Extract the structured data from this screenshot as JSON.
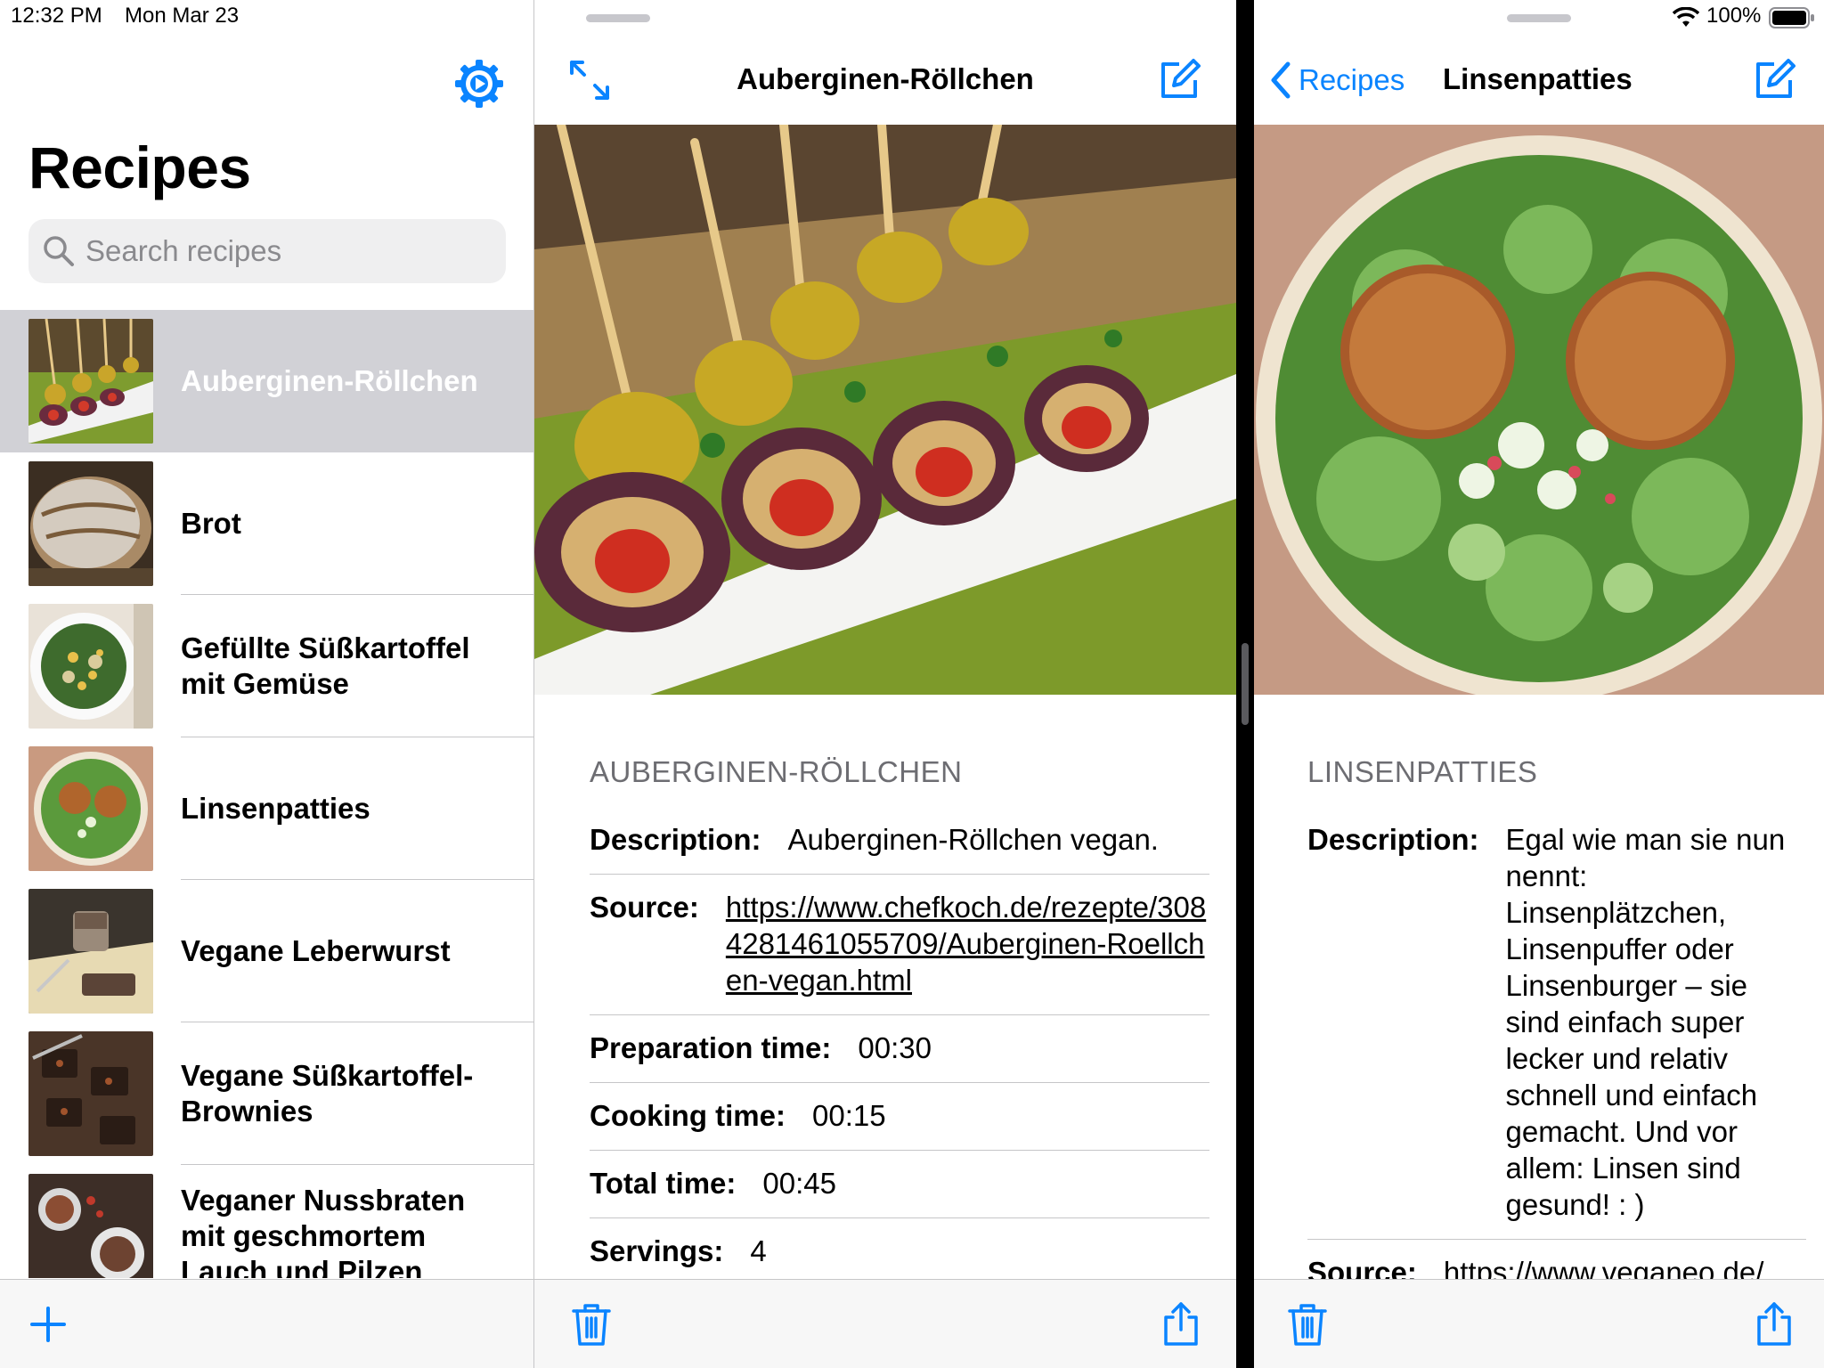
{
  "status_bar": {
    "time": "12:32 PM",
    "date": "Mon Mar 23",
    "battery": "100%"
  },
  "sidebar": {
    "title": "Recipes",
    "search_placeholder": "Search recipes",
    "items": [
      {
        "label": "Auberginen-Röllchen",
        "selected": true
      },
      {
        "label": "Brot",
        "selected": false
      },
      {
        "label": "Gefüllte Süßkartoffel mit Gemüse",
        "selected": false
      },
      {
        "label": "Linsenpatties",
        "selected": false
      },
      {
        "label": "Vegane Leberwurst",
        "selected": false
      },
      {
        "label": "Vegane Süßkartoffel-Brownies",
        "selected": false
      },
      {
        "label": "Veganer Nussbraten mit geschmortem Lauch und Pilzen",
        "selected": false
      }
    ]
  },
  "detail_left": {
    "nav_title": "Auberginen-Röllchen",
    "section_header": "AUBERGINEN-RÖLLCHEN",
    "fields": {
      "description_label": "Description:",
      "description_value": "Auberginen-Röllchen vegan.",
      "source_label": "Source:",
      "source_value": "https://www.chefkoch.de/rezepte/3084281461055709/Auberginen-Roellchen-vegan.html",
      "prep_label": "Preparation time:",
      "prep_value": "00:30",
      "cook_label": "Cooking time:",
      "cook_value": "00:15",
      "total_label": "Total time:",
      "total_value": "00:45",
      "servings_label": "Servings:",
      "servings_value": "4"
    }
  },
  "detail_right": {
    "back_label": "Recipes",
    "nav_title": "Linsenpatties",
    "section_header": "LINSENPATTIES",
    "fields": {
      "description_label": "Description:",
      "description_value": "Egal wie man sie nun nennt: Linsenplätzchen, Linsenpuffer oder Linsenburger – sie sind einfach super lecker und relativ schnell und einfach gemacht. Und vor allem: Linsen sind gesund! : )",
      "source_label": "Source:",
      "source_value": "https://www.veganeo.de/"
    }
  },
  "colors": {
    "accent": "#0a84ff",
    "selected_row": "#d1d1d6",
    "separator": "#c6c6c8",
    "section_header": "#6d6d72"
  },
  "icons": {
    "settings": "gear-icon",
    "search": "search-icon",
    "add": "plus-icon",
    "expand": "expand-icon",
    "compose": "compose-icon",
    "delete": "trash-icon",
    "share": "share-icon",
    "back": "chevron-left-icon",
    "wifi": "wifi-icon",
    "battery": "battery-icon"
  }
}
